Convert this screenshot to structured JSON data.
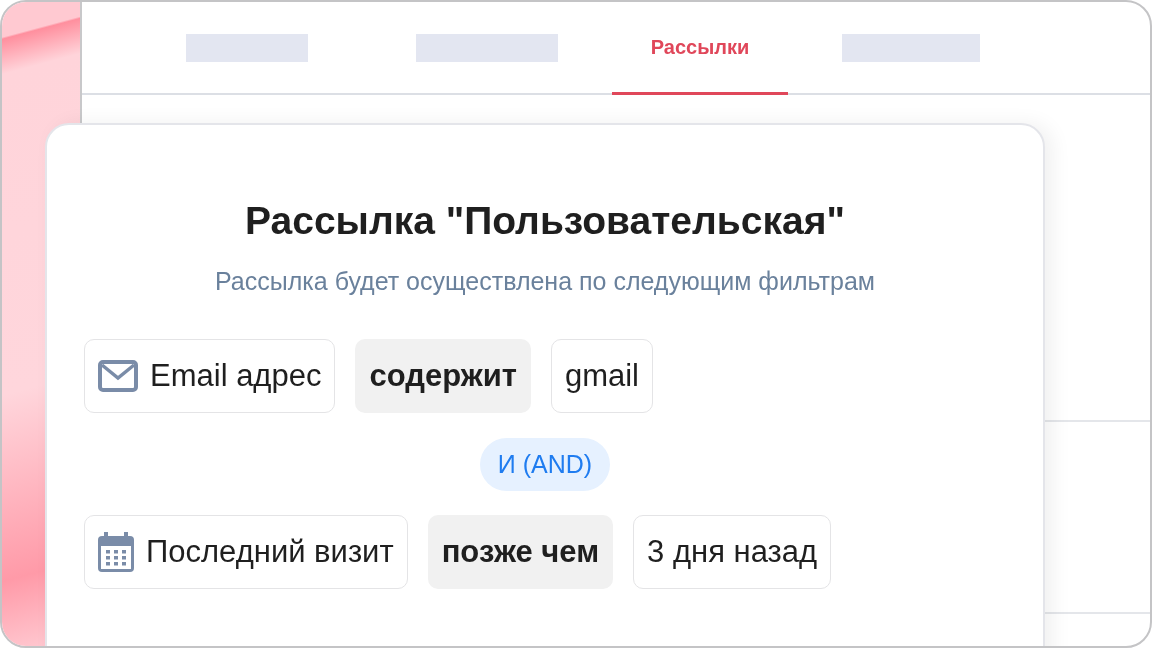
{
  "tabs": [
    {
      "kind": "placeholder",
      "selected": false
    },
    {
      "kind": "placeholder",
      "selected": false
    },
    {
      "kind": "label",
      "label": "Рассылки",
      "selected": true
    },
    {
      "kind": "placeholder",
      "selected": false
    }
  ],
  "dialog": {
    "title": "Рассылка \"Пользовательская\"",
    "subtitle": "Рассылка будет осуществлена по следующим фильтрам"
  },
  "filters": [
    {
      "kind": "email",
      "field": "Email адрес",
      "operator": "содержит",
      "value": "gmail"
    },
    {
      "kind": "date",
      "field": "Последний визит",
      "operator": "позже чем",
      "value": "3 дня назад"
    }
  ],
  "joiner": "И (AND)"
}
